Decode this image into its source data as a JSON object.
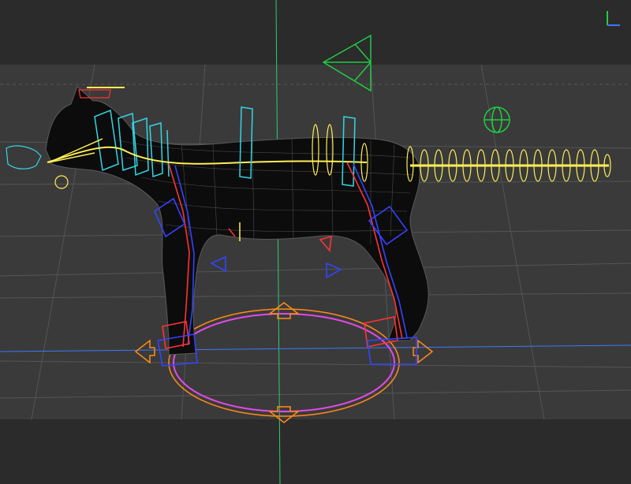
{
  "app": {
    "title": ""
  },
  "viewport": {
    "background": "#343434",
    "band_top": "#2a2a2a",
    "band_bottom": "#2a2a2a",
    "grid_color": "#555555",
    "y_axis_color": "#2ecc71",
    "x_axis_color": "#3a78ff"
  },
  "rig_colors": {
    "mesh": "#0b0b0b",
    "wire": "#6a6a6a",
    "spine": "#ffee55",
    "neck_cubes": "#33d6e6",
    "front_leg_ik": "#ff3333",
    "leg_controls": "#3344ff",
    "root_ellipse": "#e04be8",
    "root_arrows": "#ff8c1a",
    "light_cone": "#22cc44",
    "globe": "#22cc44"
  },
  "icons": [
    "axis-indicator-icon",
    "light-cone-icon",
    "globe-icon",
    "root-control-icon"
  ]
}
